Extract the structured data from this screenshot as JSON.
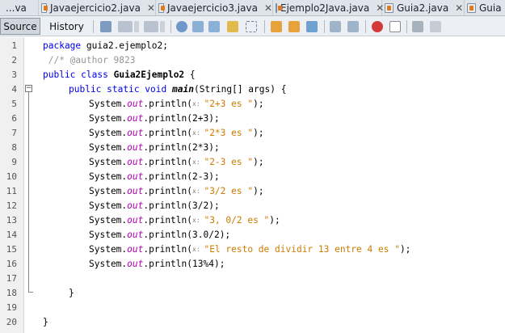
{
  "tabs": [
    {
      "label": "...va",
      "show_icon": false,
      "show_close": false
    },
    {
      "label": "Javaejercicio2.java",
      "show_icon": true,
      "show_close": true
    },
    {
      "label": "Javaejercicio3.java",
      "show_icon": true,
      "show_close": true
    },
    {
      "label": "Ejemplo2Java.java",
      "show_icon": true,
      "show_close": true
    },
    {
      "label": "Guia2.java",
      "show_icon": true,
      "show_close": true
    },
    {
      "label": "Guia",
      "show_icon": true,
      "show_close": false
    }
  ],
  "toolbar": {
    "source_label": "Source",
    "history_label": "History",
    "close_glyph": "✕"
  },
  "editor": {
    "line_numbers": [
      "1",
      "2",
      "3",
      "4",
      "5",
      "6",
      "7",
      "8",
      "9",
      "10",
      "11",
      "12",
      "13",
      "14",
      "15",
      "16",
      "17",
      "18",
      "19",
      "20"
    ],
    "fold_glyph": "−",
    "line1": {
      "kw": "package",
      "rest": " guia2.ejemplo2;"
    },
    "line2": {
      "text": " //* @author 9823"
    },
    "line3": {
      "kw1": "public",
      "kw2": "class",
      "name": "Guia2Ejemplo2",
      "rest": " {"
    },
    "line4": {
      "kw": "public static void",
      "method": "main",
      "rest": "(String[] args) {"
    },
    "prints": [
      {
        "hint": "x:",
        "arg": "\"2+3 es \"",
        "is_string": true,
        "end": ");"
      },
      {
        "hint": "",
        "arg": "2+3",
        "is_string": false,
        "end": ");"
      },
      {
        "hint": "x:",
        "arg": "\"2*3 es \"",
        "is_string": true,
        "end": ");"
      },
      {
        "hint": "",
        "arg": "2*3",
        "is_string": false,
        "end": ");"
      },
      {
        "hint": "x:",
        "arg": "\"2-3 es \"",
        "is_string": true,
        "end": ");"
      },
      {
        "hint": "",
        "arg": "2-3",
        "is_string": false,
        "end": ");"
      },
      {
        "hint": "x:",
        "arg": "\"3/2 es \"",
        "is_string": true,
        "end": ");"
      },
      {
        "hint": "",
        "arg": "3/2",
        "is_string": false,
        "end": ");"
      },
      {
        "hint": "x:",
        "arg": "\"3, 0/2 es \"",
        "is_string": true,
        "end": ");"
      },
      {
        "hint": "",
        "arg": "3.0/2",
        "is_string": false,
        "end": ");"
      },
      {
        "hint": "x:",
        "arg": "\"El resto de dividir 13 entre 4 es \"",
        "is_string": true,
        "end": ");"
      },
      {
        "hint": "",
        "arg": "13%4",
        "is_string": false,
        "end": ");"
      }
    ],
    "print_prefix": "System.",
    "print_field": "out",
    "print_method": ".println(",
    "line18": "}",
    "line20": "}"
  }
}
